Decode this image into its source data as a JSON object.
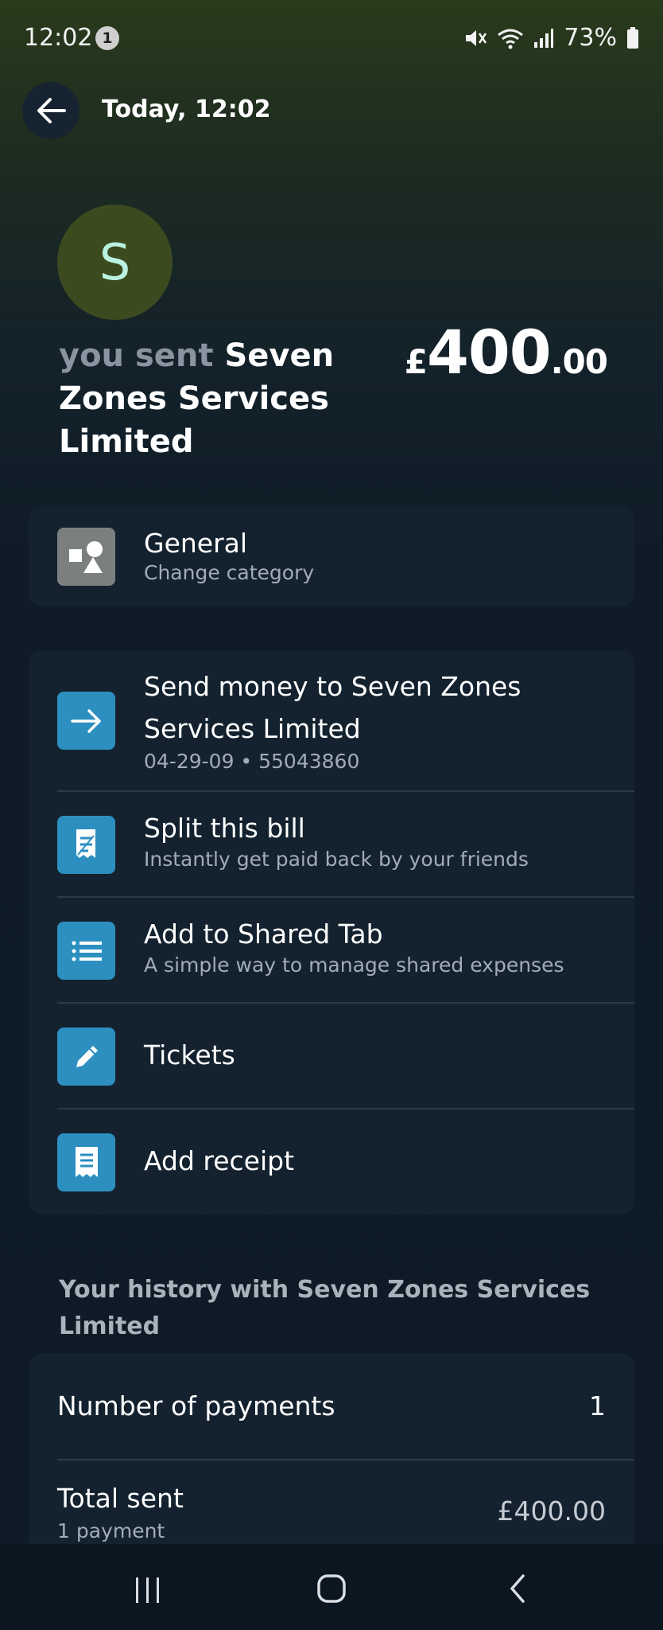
{
  "status_bar": {
    "time": "12:02",
    "notification_count": "1",
    "battery": "73%"
  },
  "header": {
    "title": "Today, 12:02"
  },
  "transaction": {
    "avatar_letter": "S",
    "prefix": "you sent",
    "recipient": "Seven Zones Services Limited",
    "amount_currency": "£",
    "amount_major": "400",
    "amount_minor": ".00"
  },
  "category": {
    "title": "General",
    "subtitle": "Change category"
  },
  "actions": [
    {
      "title": "Send money to Seven Zones Services Limited",
      "subtitle": "04-29-09 • 55043860",
      "icon": "arrow-right-icon"
    },
    {
      "title": "Split this bill",
      "subtitle": "Instantly get paid back by your friends",
      "icon": "split-bill-icon"
    },
    {
      "title": "Add to Shared Tab",
      "subtitle": "A simple way to manage shared expenses",
      "icon": "list-icon"
    },
    {
      "title": "Tickets",
      "subtitle": "",
      "icon": "pencil-icon"
    },
    {
      "title": "Add receipt",
      "subtitle": "",
      "icon": "receipt-icon"
    }
  ],
  "history": {
    "title": "Your history with Seven Zones Services Limited",
    "rows": [
      {
        "label": "Number of payments",
        "value": "1",
        "sub": ""
      },
      {
        "label": "Total sent",
        "value": "£400.00",
        "sub": "1 payment"
      }
    ]
  },
  "colors": {
    "accent_blue": "#2c8fc0",
    "card_bg": "#14222f",
    "avatar_bg": "#3c4a1f"
  }
}
